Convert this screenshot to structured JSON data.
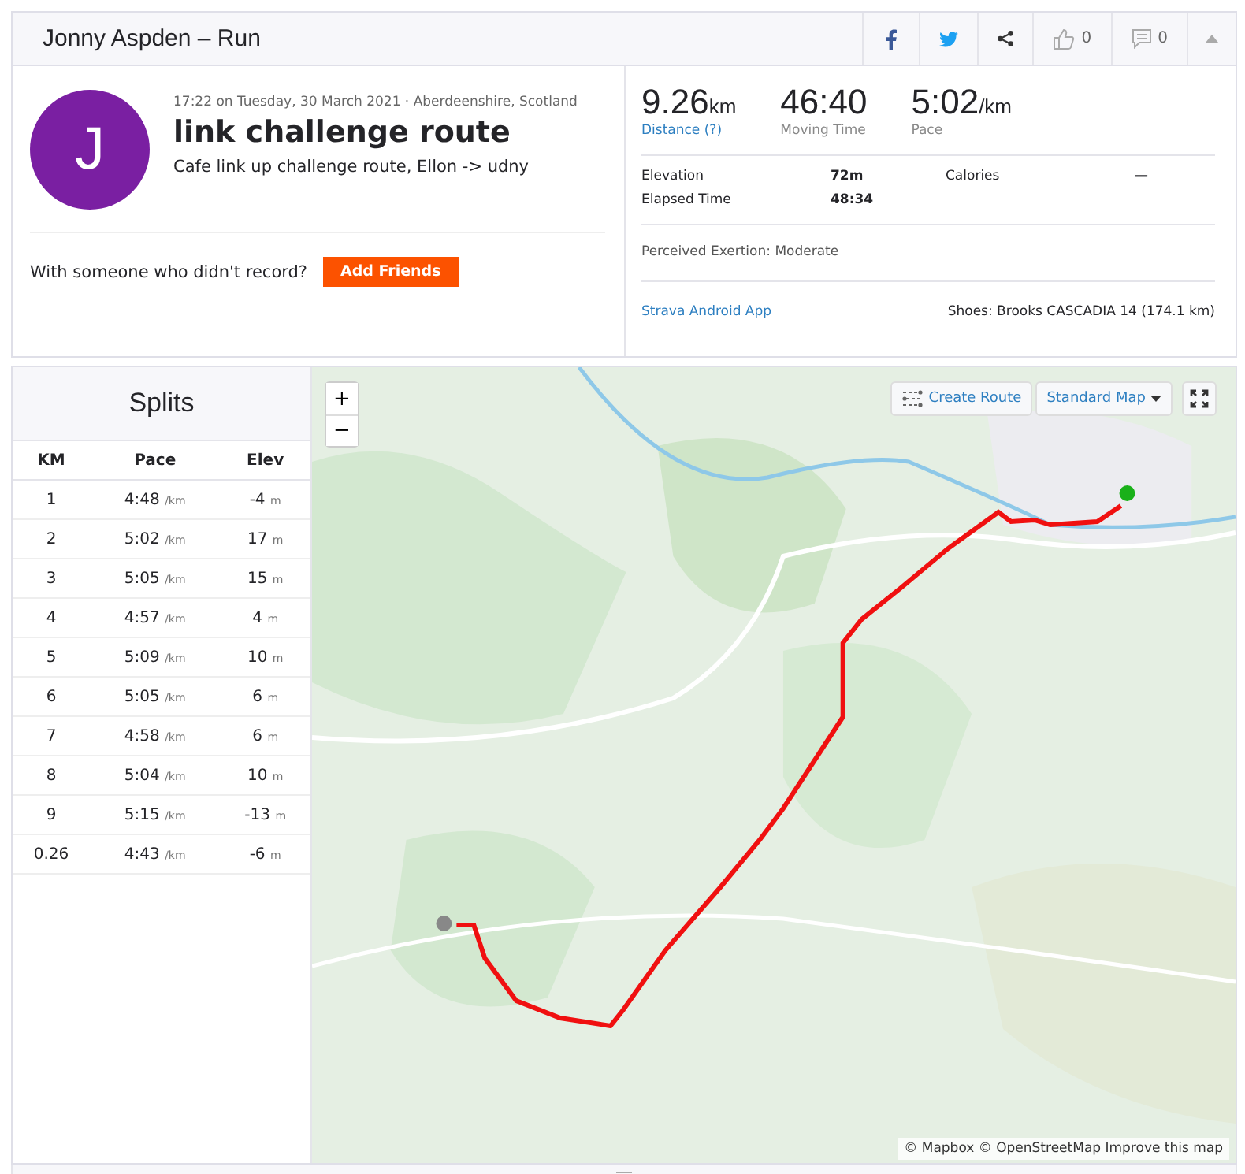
{
  "header": {
    "title": "Jonny Aspden – Run",
    "like_count": "0",
    "comment_count": "0"
  },
  "activity": {
    "avatar_letter": "J",
    "meta": "17:22 on Tuesday, 30 March 2021 · Aberdeenshire, Scotland",
    "title": "link challenge route",
    "description": "Cafe link up challenge route, Ellon -> udny",
    "friends_prompt": "With someone who didn't record?",
    "friends_button": "Add Friends"
  },
  "stats": [
    {
      "value": "9.26",
      "unit": "km",
      "label": "Distance (?)",
      "link": true
    },
    {
      "value": "46:40",
      "label": "Moving Time",
      "link": false
    },
    {
      "value": "5:02",
      "unit": "/km",
      "label": "Pace",
      "link": false
    }
  ],
  "details": [
    {
      "label": "Elevation",
      "value": "72m"
    },
    {
      "label": "Calories",
      "value": "—"
    },
    {
      "label": "Elapsed Time",
      "value": "48:34"
    }
  ],
  "exertion": "Perceived Exertion: Moderate",
  "device_link": "Strava Android App",
  "shoes": "Shoes: Brooks CASCADIA 14 (174.1 km)",
  "splits": {
    "title": "Splits",
    "columns": [
      "KM",
      "Pace",
      "Elev"
    ],
    "rows": [
      {
        "km": "1",
        "pace": "4:48",
        "pace_unit": "/km",
        "elev": "-4",
        "elev_unit": "m"
      },
      {
        "km": "2",
        "pace": "5:02",
        "pace_unit": "/km",
        "elev": "17",
        "elev_unit": "m"
      },
      {
        "km": "3",
        "pace": "5:05",
        "pace_unit": "/km",
        "elev": "15",
        "elev_unit": "m"
      },
      {
        "km": "4",
        "pace": "4:57",
        "pace_unit": "/km",
        "elev": "4",
        "elev_unit": "m"
      },
      {
        "km": "5",
        "pace": "5:09",
        "pace_unit": "/km",
        "elev": "10",
        "elev_unit": "m"
      },
      {
        "km": "6",
        "pace": "5:05",
        "pace_unit": "/km",
        "elev": "6",
        "elev_unit": "m"
      },
      {
        "km": "7",
        "pace": "4:58",
        "pace_unit": "/km",
        "elev": "6",
        "elev_unit": "m"
      },
      {
        "km": "8",
        "pace": "5:04",
        "pace_unit": "/km",
        "elev": "10",
        "elev_unit": "m"
      },
      {
        "km": "9",
        "pace": "5:15",
        "pace_unit": "/km",
        "elev": "-13",
        "elev_unit": "m"
      },
      {
        "km": "0.26",
        "pace": "4:43",
        "pace_unit": "/km",
        "elev": "-6",
        "elev_unit": "m"
      }
    ]
  },
  "map": {
    "zoom_in": "+",
    "zoom_out": "−",
    "create_route": "Create Route",
    "map_style": "Standard Map",
    "attribution": "© Mapbox © OpenStreetMap Improve this map"
  }
}
